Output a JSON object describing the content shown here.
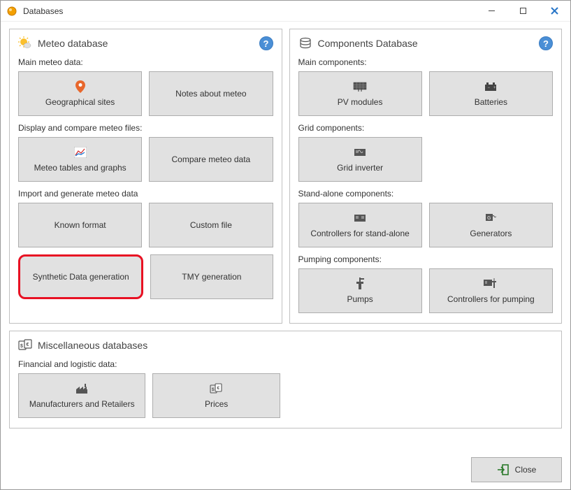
{
  "window": {
    "title": "Databases",
    "close_label": "Close"
  },
  "meteo": {
    "title": "Meteo database",
    "sections": {
      "main": "Main meteo data:",
      "display": "Display and compare meteo files:",
      "import": "Import and generate meteo data"
    },
    "buttons": {
      "geo_sites": "Geographical sites",
      "notes": "Notes about meteo",
      "tables_graphs": "Meteo tables and graphs",
      "compare": "Compare meteo data",
      "known_format": "Known format",
      "custom_file": "Custom file",
      "synthetic": "Synthetic Data generation",
      "tmy": "TMY generation"
    }
  },
  "components": {
    "title": "Components Database",
    "sections": {
      "main": "Main components:",
      "grid": "Grid components:",
      "standalone": "Stand-alone components:",
      "pumping": "Pumping components:"
    },
    "buttons": {
      "pv_modules": "PV modules",
      "batteries": "Batteries",
      "grid_inverter": "Grid inverter",
      "controllers_standalone": "Controllers for stand-alone",
      "generators": "Generators",
      "pumps": "Pumps",
      "controllers_pumping": "Controllers for pumping"
    }
  },
  "misc": {
    "title": "Miscellaneous databases",
    "sections": {
      "financial": "Financial and logistic data:"
    },
    "buttons": {
      "manufacturers": "Manufacturers and Retailers",
      "prices": "Prices"
    }
  }
}
